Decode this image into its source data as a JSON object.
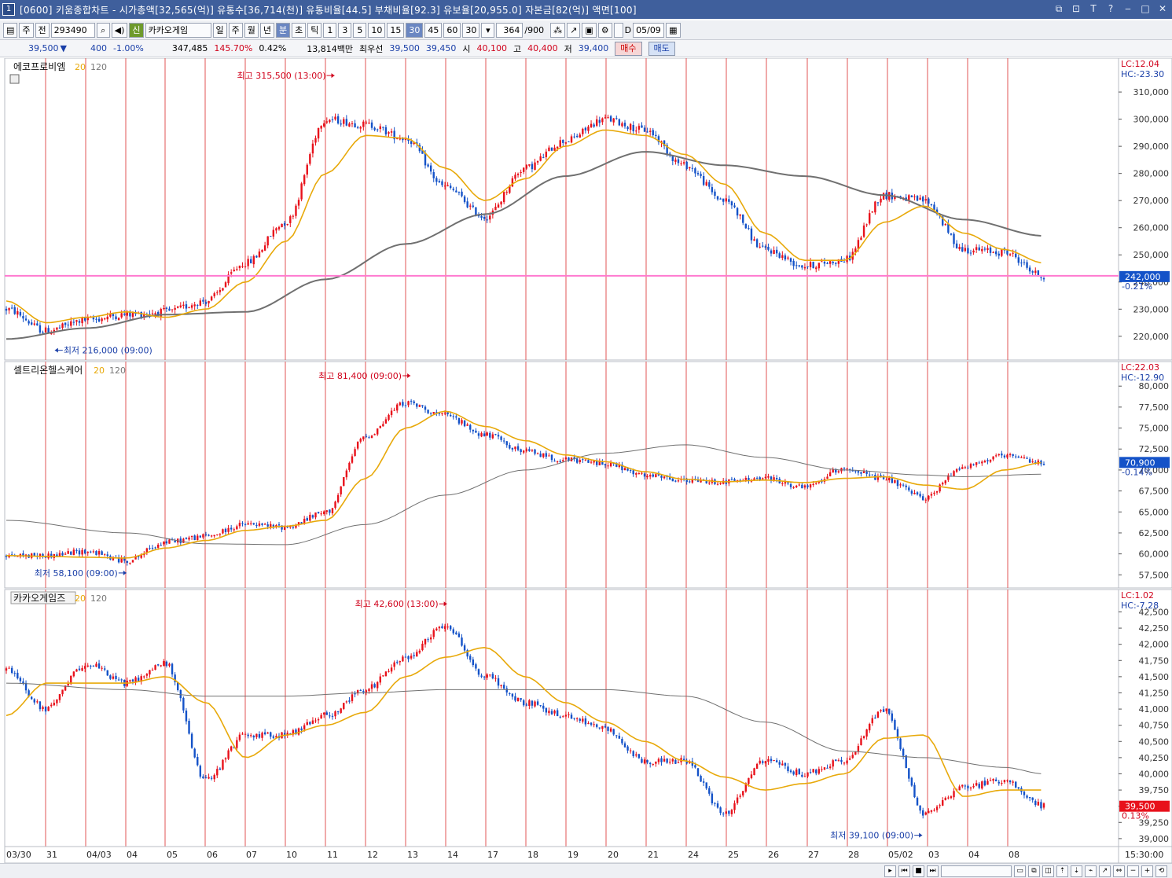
{
  "window": {
    "number": "1",
    "title": "[0600] 키움종합차트 - 시가총액[32,565(억)] 유통수[36,714(천)] 유통비율[44.5] 부채비율[92.3] 유보율[20,955.0] 자본금[82(억)] 액면[100]"
  },
  "toolbar": {
    "btn_ju": "주",
    "btn_jeon": "전",
    "code": "293490",
    "stock_name": "카카오게임",
    "flag": "신",
    "periods": [
      "일",
      "주",
      "월",
      "년",
      "분",
      "초",
      "틱"
    ],
    "active_period": "분",
    "minutes": [
      "1",
      "3",
      "5",
      "10",
      "15",
      "30",
      "45",
      "60"
    ],
    "active_minute": "30",
    "interval_select": "30",
    "count": "364",
    "count_total": "/900",
    "checkbox_label": "D",
    "date": "05/09"
  },
  "quote": {
    "price": "39,500",
    "direction": "▼",
    "change": "400",
    "change_pct": "-1.00%",
    "volume": "347,485",
    "volume_ratio": "145.70%",
    "turnover": "0.42%",
    "amount": "13,814백만",
    "best_label": "최우선",
    "best_ask": "39,500",
    "best_bid": "39,450",
    "open_label": "시",
    "open": "40,100",
    "high_label": "고",
    "high": "40,400",
    "low_label": "저",
    "low": "39,400",
    "buy_label": "매수",
    "sell_label": "매도"
  },
  "x_axis": {
    "dates": [
      "03/30",
      "31",
      "04/03",
      "04",
      "05",
      "06",
      "07",
      "10",
      "11",
      "12",
      "13",
      "14",
      "17",
      "18",
      "19",
      "20",
      "21",
      "24",
      "25",
      "26",
      "27",
      "28",
      "05/02",
      "03",
      "04",
      "08"
    ],
    "time": "15:30:00"
  },
  "panels": [
    {
      "name": "에코프로비엠",
      "ma_short": "20",
      "ma_long": "120",
      "lc": "LC:12.04",
      "hc": "HC:-23.30",
      "ticks": [
        "310,000",
        "300,000",
        "290,000",
        "280,000",
        "270,000",
        "260,000",
        "250,000",
        "240,000",
        "230,000",
        "220,000"
      ],
      "ymin": 213000,
      "ymax": 319000,
      "current": "242,000",
      "current_pct": "-0.21%",
      "hline": 242300,
      "high_note": "최고 315,500 (13:00)",
      "low_note": "최저 216,000 (09:00)",
      "colors": {
        "ma_short": "#e8a90a",
        "ma_long": "#707070",
        "hline": "#ff7ad0"
      },
      "chart_data": {
        "type": "candlestick",
        "close_anchors": [
          [
            0,
            230000
          ],
          [
            1,
            222000
          ],
          [
            2,
            226000
          ],
          [
            3,
            228000
          ],
          [
            4,
            229000
          ],
          [
            5,
            233000
          ],
          [
            6,
            247000
          ],
          [
            7,
            262000
          ],
          [
            8,
            300000
          ],
          [
            9,
            298000
          ],
          [
            10,
            293000
          ],
          [
            11,
            275000
          ],
          [
            12,
            264000
          ],
          [
            13,
            282000
          ],
          [
            14,
            292000
          ],
          [
            15,
            300000
          ],
          [
            16,
            296000
          ],
          [
            17,
            283000
          ],
          [
            18,
            270000
          ],
          [
            19,
            252000
          ],
          [
            20,
            246000
          ],
          [
            21,
            248000
          ],
          [
            22,
            272000
          ],
          [
            23,
            270000
          ],
          [
            24,
            252000
          ],
          [
            25,
            251000
          ],
          [
            26,
            242000
          ]
        ],
        "ma20_anchors": [
          [
            0,
            233000
          ],
          [
            1,
            225000
          ],
          [
            2,
            227000
          ],
          [
            3,
            229000
          ],
          [
            4,
            227000
          ],
          [
            5,
            230000
          ],
          [
            6,
            240000
          ],
          [
            7,
            255000
          ],
          [
            8,
            280000
          ],
          [
            9,
            294000
          ],
          [
            10,
            293000
          ],
          [
            11,
            282000
          ],
          [
            12,
            270000
          ],
          [
            13,
            278000
          ],
          [
            14,
            290000
          ],
          [
            15,
            296000
          ],
          [
            16,
            294000
          ],
          [
            17,
            287000
          ],
          [
            18,
            276000
          ],
          [
            19,
            258000
          ],
          [
            20,
            248000
          ],
          [
            21,
            248000
          ],
          [
            22,
            262000
          ],
          [
            23,
            268000
          ],
          [
            24,
            258000
          ],
          [
            25,
            252000
          ],
          [
            26,
            247000
          ]
        ],
        "ma120_anchors": [
          [
            0,
            219000
          ],
          [
            2,
            223000
          ],
          [
            4,
            228000
          ],
          [
            6,
            229000
          ],
          [
            8,
            241000
          ],
          [
            10,
            254000
          ],
          [
            12,
            265000
          ],
          [
            14,
            279000
          ],
          [
            16,
            288000
          ],
          [
            18,
            283000
          ],
          [
            20,
            279000
          ],
          [
            22,
            272000
          ],
          [
            24,
            263000
          ],
          [
            26,
            257000
          ]
        ],
        "high": 315500,
        "low": 216000
      }
    },
    {
      "name": "셀트리온헬스케어",
      "ma_short": "20",
      "ma_long": "120",
      "lc": "LC:22.03",
      "hc": "HC:-12.90",
      "ticks": [
        "80,000",
        "77,500",
        "75,000",
        "72,500",
        "70,000",
        "67,500",
        "65,000",
        "62,500",
        "60,000",
        "57,500"
      ],
      "ymin": 56500,
      "ymax": 81800,
      "current": "70,900",
      "current_pct": "-0.14%",
      "high_note": "최고 81,400 (09:00)",
      "low_note": "최저 58,100 (09:00)",
      "colors": {
        "ma_short": "#e8a90a",
        "ma_long": "#707070"
      },
      "chart_data": {
        "type": "candlestick",
        "close_anchors": [
          [
            0,
            59800
          ],
          [
            1,
            59800
          ],
          [
            2,
            60300
          ],
          [
            3,
            59200
          ],
          [
            4,
            61400
          ],
          [
            5,
            62100
          ],
          [
            6,
            63500
          ],
          [
            7,
            63200
          ],
          [
            8,
            64900
          ],
          [
            9,
            74000
          ],
          [
            10,
            78000
          ],
          [
            11,
            76500
          ],
          [
            12,
            74200
          ],
          [
            13,
            72200
          ],
          [
            14,
            71200
          ],
          [
            15,
            70800
          ],
          [
            16,
            69300
          ],
          [
            17,
            68700
          ],
          [
            18,
            68600
          ],
          [
            19,
            69000
          ],
          [
            20,
            67900
          ],
          [
            21,
            70200
          ],
          [
            22,
            68900
          ],
          [
            23,
            66700
          ],
          [
            24,
            70500
          ],
          [
            25,
            71600
          ],
          [
            26,
            70900
          ]
        ],
        "ma20_anchors": [
          [
            0,
            59800
          ],
          [
            1,
            59700
          ],
          [
            2,
            59600
          ],
          [
            3,
            59500
          ],
          [
            4,
            60700
          ],
          [
            5,
            61600
          ],
          [
            6,
            62800
          ],
          [
            7,
            63300
          ],
          [
            8,
            64000
          ],
          [
            9,
            69000
          ],
          [
            10,
            75000
          ],
          [
            11,
            77000
          ],
          [
            12,
            75200
          ],
          [
            13,
            73500
          ],
          [
            14,
            71800
          ],
          [
            15,
            71000
          ],
          [
            16,
            69800
          ],
          [
            17,
            68900
          ],
          [
            18,
            68600
          ],
          [
            19,
            68800
          ],
          [
            20,
            68500
          ],
          [
            21,
            69000
          ],
          [
            22,
            69200
          ],
          [
            23,
            68200
          ],
          [
            24,
            67700
          ],
          [
            25,
            70000
          ],
          [
            26,
            70900
          ]
        ],
        "ma120_anchors": [
          [
            0,
            64000
          ],
          [
            3,
            62500
          ],
          [
            5,
            61200
          ],
          [
            7,
            61100
          ],
          [
            9,
            63500
          ],
          [
            11,
            67000
          ],
          [
            13,
            70000
          ],
          [
            15,
            72000
          ],
          [
            17,
            73000
          ],
          [
            19,
            71500
          ],
          [
            21,
            70000
          ],
          [
            23,
            69400
          ],
          [
            24,
            69200
          ],
          [
            26,
            69500
          ]
        ],
        "high": 81400,
        "low": 58100
      }
    },
    {
      "name": "카카오게임즈",
      "ma_short": "20",
      "ma_long": "120",
      "lc": "LC:1.02",
      "hc": "HC:-7.28",
      "ticks": [
        "42,500",
        "42,250",
        "42,000",
        "41,750",
        "41,500",
        "41,250",
        "41,000",
        "40,750",
        "40,500",
        "40,250",
        "40,000",
        "39,750",
        "39,500",
        "39,250",
        "39,000"
      ],
      "ymin": 38950,
      "ymax": 42700,
      "current": "39,500",
      "current_pct": "0.13%",
      "high_note": "최고 42,600 (13:00)",
      "low_note": "최저 39,100 (09:00)",
      "colors": {
        "ma_short": "#e8a90a",
        "ma_long": "#707070"
      },
      "chart_data": {
        "type": "candlestick",
        "close_anchors": [
          [
            0,
            41600
          ],
          [
            1,
            41000
          ],
          [
            2,
            41700
          ],
          [
            3,
            41400
          ],
          [
            4,
            41700
          ],
          [
            5,
            39900
          ],
          [
            6,
            40600
          ],
          [
            7,
            40600
          ],
          [
            8,
            40900
          ],
          [
            9,
            41300
          ],
          [
            10,
            41800
          ],
          [
            11,
            42300
          ],
          [
            12,
            41500
          ],
          [
            13,
            41100
          ],
          [
            14,
            40900
          ],
          [
            15,
            40700
          ],
          [
            16,
            40200
          ],
          [
            17,
            40200
          ],
          [
            18,
            39400
          ],
          [
            19,
            40200
          ],
          [
            20,
            40000
          ],
          [
            21,
            40200
          ],
          [
            22,
            41000
          ],
          [
            23,
            39400
          ],
          [
            24,
            39800
          ],
          [
            25,
            39900
          ],
          [
            26,
            39500
          ]
        ],
        "ma20_anchors": [
          [
            0,
            40900
          ],
          [
            1,
            41400
          ],
          [
            2,
            41400
          ],
          [
            3,
            41400
          ],
          [
            4,
            41500
          ],
          [
            5,
            41100
          ],
          [
            6,
            40250
          ],
          [
            7,
            40600
          ],
          [
            8,
            40750
          ],
          [
            9,
            40950
          ],
          [
            10,
            41500
          ],
          [
            11,
            41800
          ],
          [
            12,
            41950
          ],
          [
            13,
            41500
          ],
          [
            14,
            41100
          ],
          [
            15,
            40800
          ],
          [
            16,
            40500
          ],
          [
            17,
            40200
          ],
          [
            18,
            39950
          ],
          [
            19,
            39750
          ],
          [
            20,
            39850
          ],
          [
            21,
            40000
          ],
          [
            22,
            40550
          ],
          [
            23,
            40600
          ],
          [
            24,
            39650
          ],
          [
            25,
            39750
          ],
          [
            26,
            39750
          ]
        ],
        "ma120_anchors": [
          [
            0,
            41400
          ],
          [
            3,
            41300
          ],
          [
            5,
            41200
          ],
          [
            7,
            41200
          ],
          [
            9,
            41250
          ],
          [
            11,
            41300
          ],
          [
            13,
            41300
          ],
          [
            15,
            41300
          ],
          [
            17,
            41200
          ],
          [
            19,
            40800
          ],
          [
            21,
            40350
          ],
          [
            23,
            40250
          ],
          [
            25,
            40100
          ],
          [
            26,
            40000
          ]
        ],
        "high": 42600,
        "low": 39100
      }
    }
  ]
}
